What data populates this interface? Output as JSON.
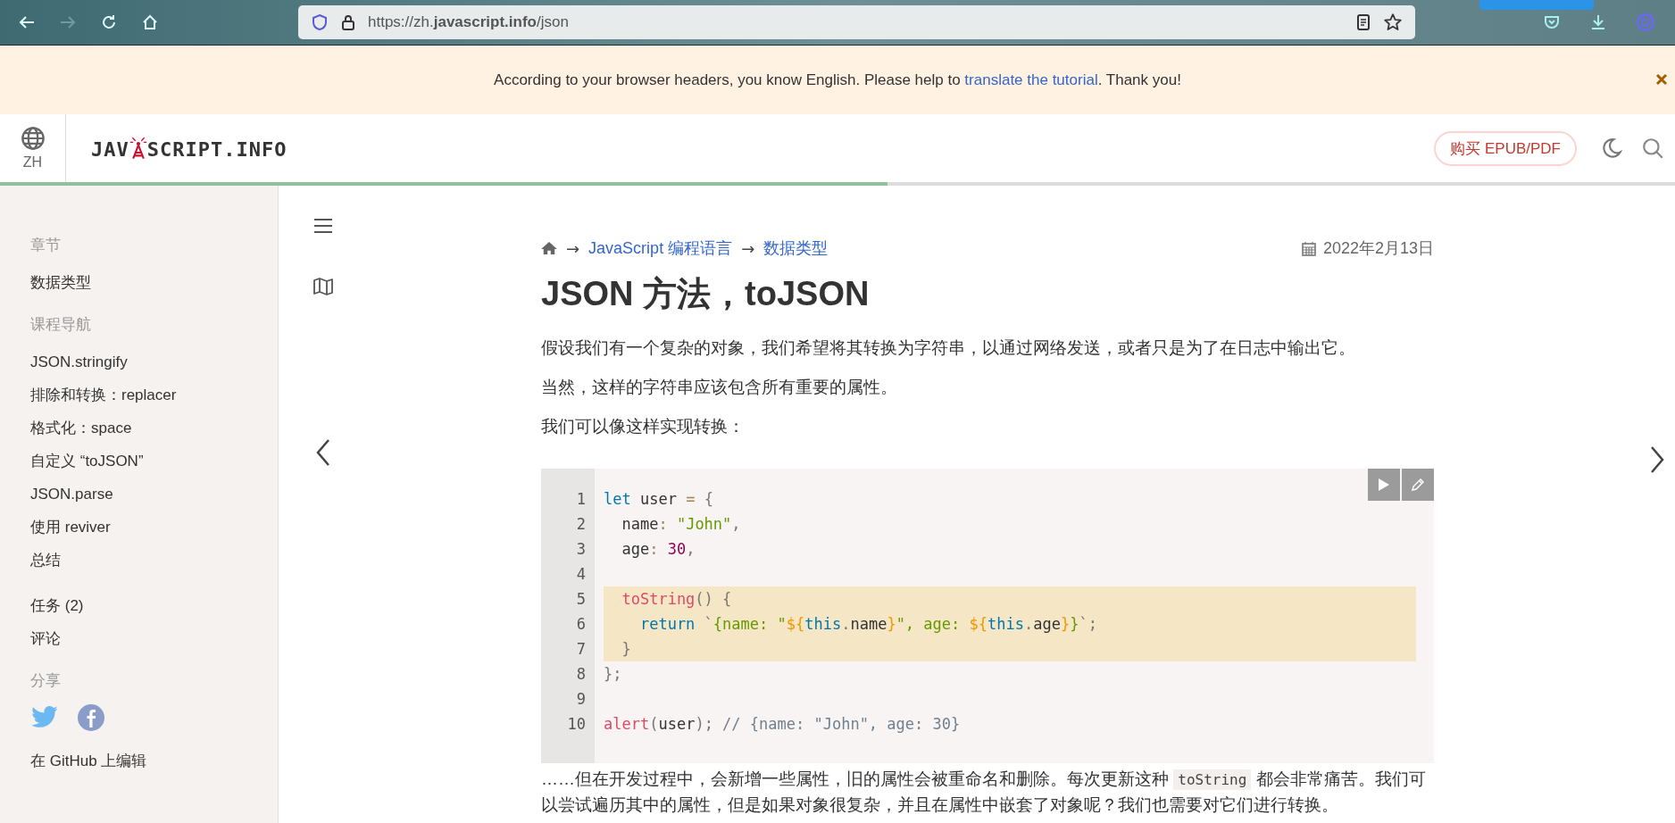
{
  "browser": {
    "nav_buttons": [
      {
        "kind": "back",
        "disabled": false
      },
      {
        "kind": "forward",
        "disabled": true
      },
      {
        "kind": "reload",
        "disabled": false
      },
      {
        "kind": "home",
        "disabled": false
      }
    ],
    "url": "https://zh.**javascript.info**/json"
  },
  "notice": {
    "text_before": "According to your browser headers, you know English. Please help to ",
    "link": "translate the tutorial",
    "text_after": ". Thank you!"
  },
  "header": {
    "language": "ZH",
    "logo": {
      "left": "JAV",
      "right": "SCRIPT.INFO"
    },
    "buy_button": "购买 EPUB/PDF",
    "progress": {
      "level": 0.53
    }
  },
  "sidebar": {
    "groups": [
      {
        "heading": "章节",
        "items": [
          "数据类型"
        ]
      },
      {
        "heading": "课程导航",
        "items": [
          "JSON.stringify",
          "排除和转换：replacer",
          "格式化：space",
          "自定义 “toJSON”",
          "JSON.parse",
          "使用 reviver",
          "总结"
        ]
      },
      {
        "items": [
          "任务 (2)",
          "评论"
        ]
      },
      {
        "heading": "分享",
        "kind": "share"
      }
    ],
    "edit_link": "在 GitHub 上编辑"
  },
  "article": {
    "breadcrumbs": [
      {
        "separator": "→",
        "label": "JavaScript 编程语言"
      },
      {
        "separator": "→",
        "label": "数据类型"
      }
    ],
    "date": "2022年2月13日",
    "title": "JSON 方法，toJSON",
    "paragraphs": [
      "假设我们有一个复杂的对象，我们希望将其转换为字符串，以通过网络发送，或者只是为了在日志中输出它。",
      "当然，这样的字符串应该包含所有重要的属性。",
      "我们可以像这样实现转换："
    ],
    "code": {
      "lines": [
        {
          "number": "1",
          "highlighted": false,
          "tokens": [
            {
              "kind": "keyword",
              "text": "let"
            },
            {
              "kind": "plain",
              "text": " user "
            },
            {
              "kind": "operator",
              "text": "="
            },
            {
              "kind": "punct",
              "text": " {"
            }
          ]
        },
        {
          "number": "2",
          "highlighted": false,
          "tokens": [
            {
              "kind": "plain",
              "text": "  name"
            },
            {
              "kind": "operator",
              "text": ":"
            },
            {
              "kind": "string",
              "text": " \"John\""
            },
            {
              "kind": "punct",
              "text": ","
            }
          ]
        },
        {
          "number": "3",
          "highlighted": false,
          "tokens": [
            {
              "kind": "plain",
              "text": "  age"
            },
            {
              "kind": "operator",
              "text": ":"
            },
            {
              "kind": "number",
              "text": " 30"
            },
            {
              "kind": "punct",
              "text": ","
            }
          ]
        },
        {
          "number": "4",
          "highlighted": false
        },
        {
          "number": "5",
          "highlighted": true,
          "tokens": [
            {
              "kind": "function",
              "text": "  toString"
            },
            {
              "kind": "punct",
              "text": "() {"
            }
          ]
        },
        {
          "number": "6",
          "highlighted": true,
          "tokens": [
            {
              "kind": "keyword",
              "text": "    return"
            },
            {
              "kind": "punct",
              "text": " `"
            },
            {
              "kind": "string",
              "text": "{name: \""
            },
            {
              "kind": "interp",
              "text": "${"
            },
            {
              "kind": "keyword",
              "text": "this"
            },
            {
              "kind": "punct",
              "text": "."
            },
            {
              "kind": "plain",
              "text": "name"
            },
            {
              "kind": "interp",
              "text": "}"
            },
            {
              "kind": "string",
              "text": "\", age: "
            },
            {
              "kind": "interp",
              "text": "${"
            },
            {
              "kind": "keyword",
              "text": "this"
            },
            {
              "kind": "punct",
              "text": "."
            },
            {
              "kind": "plain",
              "text": "age"
            },
            {
              "kind": "interp",
              "text": "}"
            },
            {
              "kind": "string",
              "text": "}"
            },
            {
              "kind": "punct",
              "text": "`;"
            }
          ]
        },
        {
          "number": "7",
          "highlighted": true,
          "tokens": [
            {
              "kind": "punct",
              "text": "  }"
            }
          ]
        },
        {
          "number": "8",
          "highlighted": false,
          "tokens": [
            {
              "kind": "punct",
              "text": "};"
            }
          ]
        },
        {
          "number": "9",
          "highlighted": false
        },
        {
          "number": "10",
          "highlighted": false,
          "tokens": [
            {
              "kind": "function",
              "text": "alert"
            },
            {
              "kind": "punct",
              "text": "("
            },
            {
              "kind": "plain",
              "text": "user"
            },
            {
              "kind": "punct",
              "text": ");"
            },
            {
              "kind": "comment",
              "text": " // {name: \"John\", age: 30}"
            }
          ]
        }
      ]
    },
    "after": [
      {
        "kind": "text",
        "text": "……但在开发过程中，会新增一些属性，旧的属性会被重命名和删除。每次更新这种 "
      },
      {
        "kind": "code",
        "text": "toString"
      },
      {
        "kind": "text",
        "text": " 都会非常痛苦。我们可以尝试遍历其中的属性，但是如果对象很复杂，并且在属性中嵌套了对象呢？我们也需要对它们进行转换。"
      }
    ]
  }
}
